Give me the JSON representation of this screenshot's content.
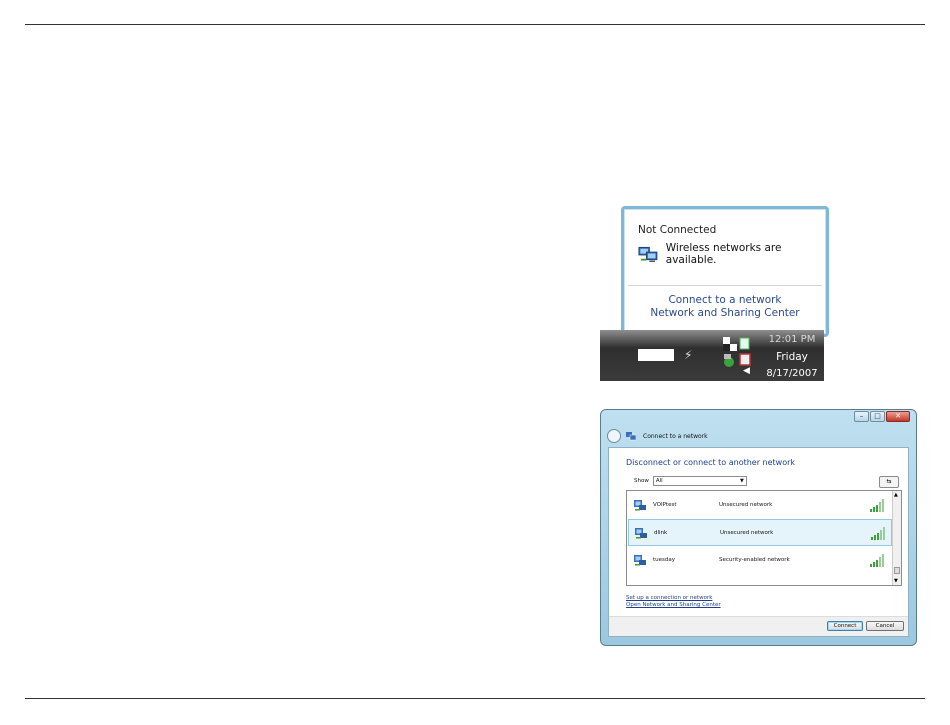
{
  "tray": {
    "balloon_title": "Not Connected",
    "balloon_message": "Wireless networks are available.",
    "link_connect": "Connect to a network",
    "link_sharing": "Network and Sharing Center",
    "clock_time": "12:01 PM",
    "clock_day": "Friday",
    "clock_date": "8/17/2007"
  },
  "window": {
    "title": "Connect to a network",
    "heading": "Disconnect or connect to another network",
    "show_label": "Show",
    "show_value": "All",
    "networks": [
      {
        "name": "VOIPtest",
        "security": "Unsecured network"
      },
      {
        "name": "dlink",
        "security": "Unsecured network"
      },
      {
        "name": "tuesday",
        "security": "Security-enabled network"
      }
    ],
    "link_setup": "Set up a connection or network",
    "link_open_sharing": "Open Network and Sharing Center",
    "connect_label": "Connect",
    "cancel_label": "Cancel"
  },
  "colors": {
    "link_blue": "#2a4b8d",
    "selection": "#e5f3fb",
    "signal_green": "#3aa33a"
  }
}
